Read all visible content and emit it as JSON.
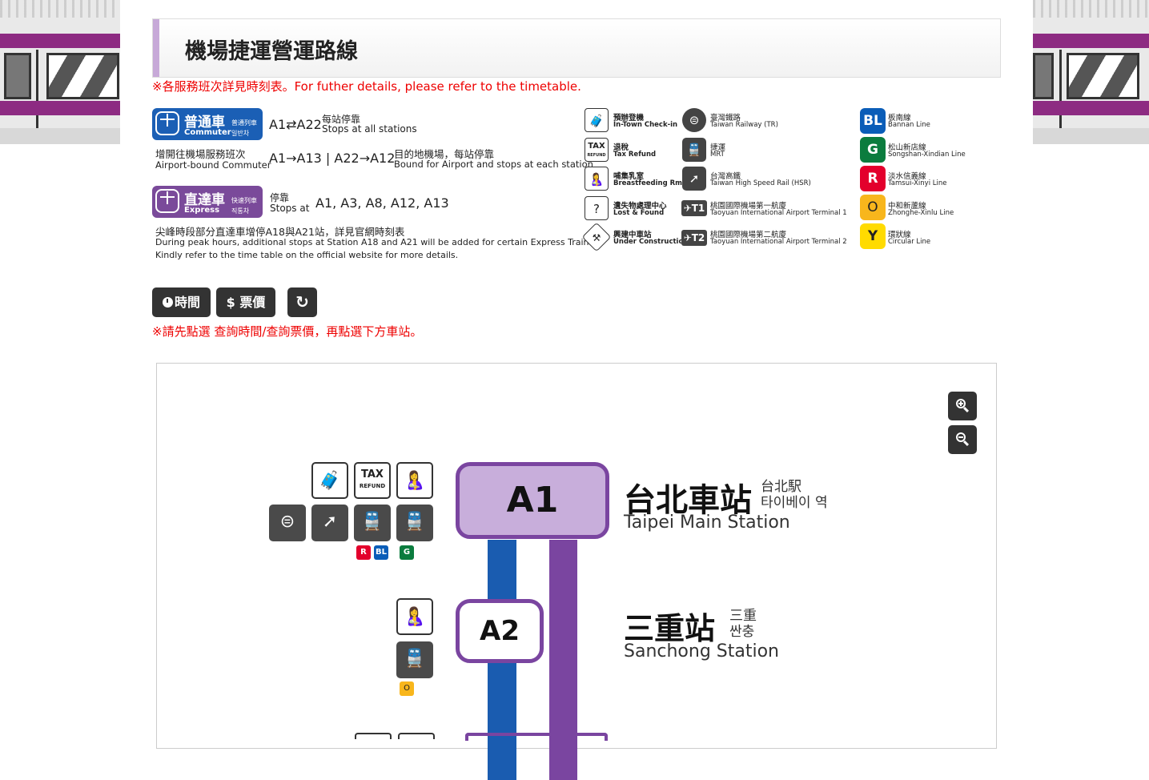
{
  "page": {
    "title": "機場捷運營運路線",
    "note_timetable": "※各服務班次詳見時刻表。For futher details, please refer to the timetable.",
    "note_click": "※請先點選 查詢時間/查詢票價，再點選下方車站。"
  },
  "services": {
    "commuter": {
      "zh": "普通車",
      "en": "Commuter",
      "jp": "普通列車",
      "kr": "일반차",
      "range": "A1⇄A22",
      "range_zh": "每站停靠",
      "range_en": "Stops at all stations",
      "airport_zh": "增開往機場服務班次",
      "airport_en": "Airport-bound Commuter",
      "airport_range": "A1→A13 | A22→A12",
      "airport_desc_zh": "目的地機場，每站停靠",
      "airport_desc_en": "Bound for Airport and stops at each station",
      "color": "#1b5fb5"
    },
    "express": {
      "zh": "直達車",
      "en": "Express",
      "jp": "快速列車",
      "kr": "직통차",
      "stops_zh": "停靠",
      "stops_en": "Stops at",
      "stops": "A1, A3, A8, A12, A13",
      "color": "#7a4a9a"
    },
    "peak_zh": "尖峰時段部分直達車增停A18與A21站，詳見官網時刻表",
    "peak_en1": "During peak hours, additional stops at Station A18 and A21 will be added for certain Express Trains.",
    "peak_en2": "Kindly refer to the time table on the official website for more details."
  },
  "legend": {
    "facilities": [
      {
        "zh": "預辦登機",
        "en": "In-Town Check-in",
        "icon": "check-in-icon"
      },
      {
        "zh": "退稅",
        "en": "Tax Refund",
        "icon": "tax-refund-icon",
        "label": "TAX",
        "sublabel": "REFUND"
      },
      {
        "zh": "哺集乳室",
        "en": "Breastfeeding Rm.",
        "icon": "breastfeeding-icon"
      },
      {
        "zh": "遺失物處理中心",
        "en": "Lost & Found",
        "icon": "lost-found-icon"
      },
      {
        "zh": "興建中車站",
        "en": "Under Construction",
        "icon": "construction-icon"
      }
    ],
    "transfers": [
      {
        "zh": "臺灣鐵路",
        "en": "Taiwan Railway (TR)",
        "icon": "tr-icon"
      },
      {
        "zh": "捷運",
        "en": "MRT",
        "icon": "mrt-icon"
      },
      {
        "zh": "台灣高鐵",
        "en": "Taiwan High Speed Rail (HSR)",
        "icon": "hsr-icon"
      },
      {
        "zh": "桃園國際機場第一航廈",
        "en": "Taoyuan International Airport Terminal 1",
        "icon": "terminal-1-icon",
        "label": "T1"
      },
      {
        "zh": "桃園國際機場第二航廈",
        "en": "Taoyuan International Airport Terminal 2",
        "icon": "terminal-2-icon",
        "label": "T2"
      }
    ],
    "lines": [
      {
        "code": "BL",
        "zh": "板南線",
        "en": "Bannan Line",
        "color": "#0a5db8"
      },
      {
        "code": "G",
        "zh": "松山新店線",
        "en": "Songshan-Xindian Line",
        "color": "#0b7c3e"
      },
      {
        "code": "R",
        "zh": "淡水信義線",
        "en": "Tamsui-Xinyi Line",
        "color": "#e3002c"
      },
      {
        "code": "O",
        "zh": "中和新蘆線",
        "en": "Zhonghe-Xinlu Line",
        "color": "#f8b61c"
      },
      {
        "code": "Y",
        "zh": "環狀線",
        "en": "Circular Line",
        "color": "#ffdb00"
      }
    ]
  },
  "buttons": {
    "time": "時間",
    "fare": "票價",
    "fare_symbol": "$",
    "reset_glyph": "↻"
  },
  "map": {
    "zoom_in": "zoom-in",
    "zoom_out": "zoom-out",
    "stations": [
      {
        "code": "A1",
        "zh": "台北車站",
        "jp": "台北駅",
        "kr": "타이베이 역",
        "en": "Taipei Main Station",
        "transfer_lines": [
          "R",
          "BL",
          "G"
        ]
      },
      {
        "code": "A2",
        "zh": "三重站",
        "jp": "三重",
        "kr": "싼충",
        "en": "Sanchong Station",
        "transfer_lines": [
          "O"
        ]
      }
    ]
  }
}
